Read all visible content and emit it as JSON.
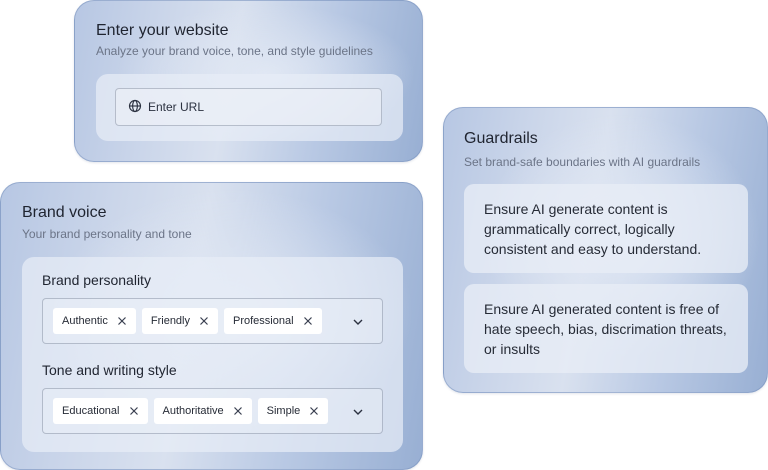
{
  "website": {
    "title": "Enter your website",
    "subtitle": "Analyze your brand voice, tone, and style guidelines",
    "url_placeholder": "Enter URL",
    "icon": "globe-icon"
  },
  "brand_voice": {
    "title": "Brand voice",
    "subtitle": "Your brand personality and tone",
    "personality": {
      "label": "Brand personality",
      "chips": [
        "Authentic",
        "Friendly",
        "Professional"
      ]
    },
    "tone": {
      "label": "Tone and writing style",
      "chips": [
        "Educational",
        "Authoritative",
        "Simple"
      ]
    }
  },
  "guardrails": {
    "title": "Guardrails",
    "subtitle": "Set brand-safe boundaries with AI guardrails",
    "rules": [
      "Ensure AI generate content is grammatically correct, logically consistent and easy to understand.",
      "Ensure AI generated content is free of hate speech, bias, discrimation threats, or insults"
    ]
  }
}
